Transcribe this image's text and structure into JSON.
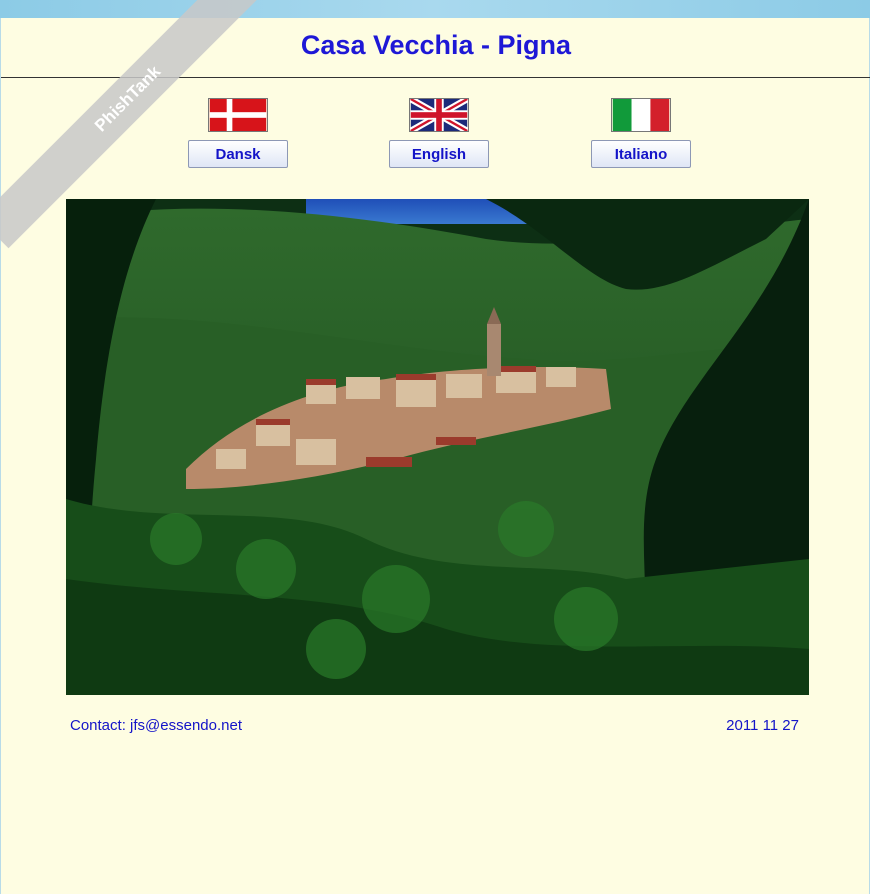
{
  "page": {
    "title": "Casa Vecchia - Pigna",
    "watermark": "PhishTank"
  },
  "languages": [
    {
      "label": "Dansk",
      "flag": "denmark-flag-icon"
    },
    {
      "label": "English",
      "flag": "united-kingdom-flag-icon"
    },
    {
      "label": "Italiano",
      "flag": "italy-flag-icon"
    }
  ],
  "photo": {
    "subject": "hillside village of Pigna among green forest"
  },
  "footer": {
    "contact_label": "Contact:",
    "contact_email": "jfs@essendo.net",
    "date": "2011 11 27"
  },
  "colors": {
    "background": "#fefde2",
    "title": "#1e18d6",
    "link_text": "#1414c8",
    "top_strip": "#8ccbe6"
  }
}
